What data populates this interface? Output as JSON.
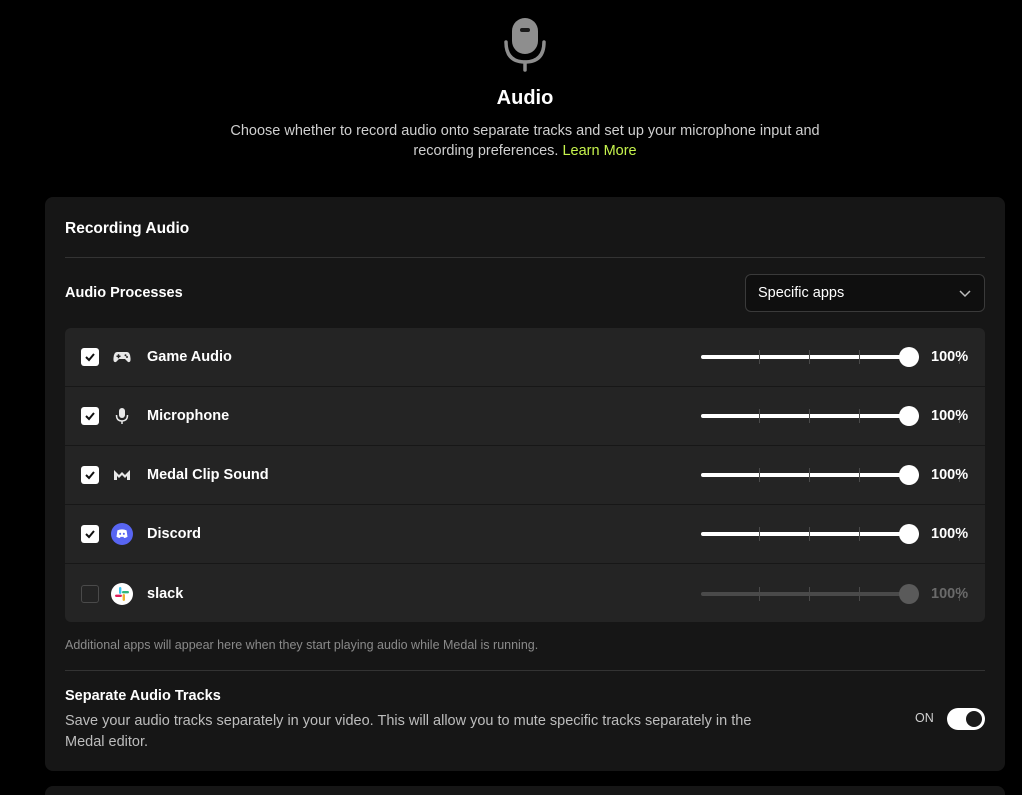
{
  "header": {
    "title": "Audio",
    "description": "Choose whether to record audio onto separate tracks and set up your microphone input and recording preferences.",
    "learn_more": "Learn More"
  },
  "recording_audio": {
    "section_title": "Recording Audio",
    "processes_label": "Audio Processes",
    "processes_select": "Specific apps",
    "apps": [
      {
        "name": "Game Audio",
        "checked": true,
        "volume": "100%",
        "volume_value": 100,
        "icon": "gamepad-icon"
      },
      {
        "name": "Microphone",
        "checked": true,
        "volume": "100%",
        "volume_value": 100,
        "icon": "microphone-icon"
      },
      {
        "name": "Medal Clip Sound",
        "checked": true,
        "volume": "100%",
        "volume_value": 100,
        "icon": "medal-logo-icon"
      },
      {
        "name": "Discord",
        "checked": true,
        "volume": "100%",
        "volume_value": 100,
        "icon": "discord-icon"
      },
      {
        "name": "slack",
        "checked": false,
        "volume": "100%",
        "volume_value": 100,
        "icon": "slack-icon"
      }
    ],
    "note": "Additional apps will appear here when they start playing audio while Medal is running."
  },
  "separate_tracks": {
    "title": "Separate Audio Tracks",
    "description": "Save your audio tracks separately in your video. This will allow you to mute specific tracks separately in the Medal editor.",
    "toggle_label": "ON",
    "enabled": true
  },
  "colors": {
    "accent_link": "#c6f34d",
    "discord": "#5865f2",
    "card_bg": "#161616",
    "list_bg": "#242424"
  }
}
